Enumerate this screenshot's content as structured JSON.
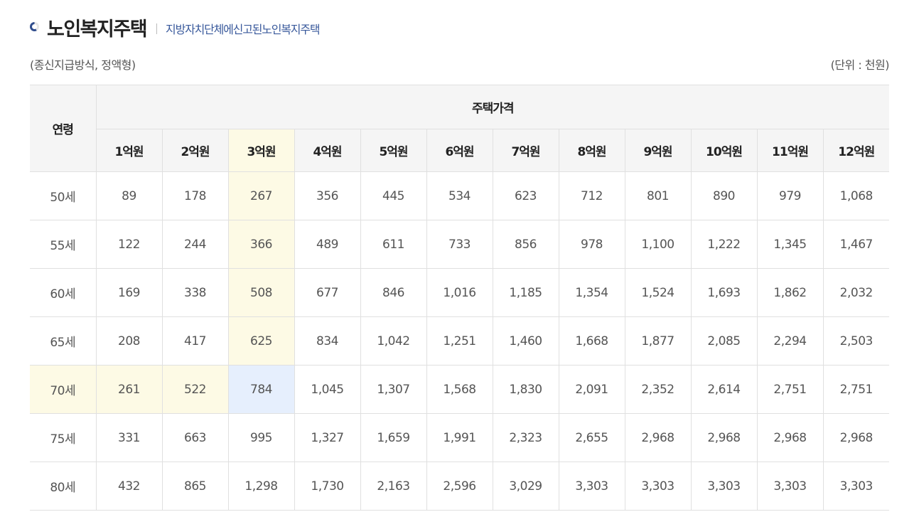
{
  "page": {
    "title": "노인복지주택",
    "subtitle": "지방자치단체에신고된노인복지주택",
    "note_left": "(종신지급방식, 정액형)",
    "note_right": "(단위 : 천원)"
  },
  "table": {
    "age_header": "연령",
    "group_header": "주택가격",
    "columns": [
      "1억원",
      "2억원",
      "3억원",
      "4억원",
      "5억원",
      "6억원",
      "7억원",
      "8억원",
      "9억원",
      "10억원",
      "11억원",
      "12억원"
    ],
    "highlight": {
      "column": "3억원",
      "row": "70세"
    },
    "rows": [
      {
        "age": "50세",
        "values": [
          "89",
          "178",
          "267",
          "356",
          "445",
          "534",
          "623",
          "712",
          "801",
          "890",
          "979",
          "1,068"
        ]
      },
      {
        "age": "55세",
        "values": [
          "122",
          "244",
          "366",
          "489",
          "611",
          "733",
          "856",
          "978",
          "1,100",
          "1,222",
          "1,345",
          "1,467"
        ]
      },
      {
        "age": "60세",
        "values": [
          "169",
          "338",
          "508",
          "677",
          "846",
          "1,016",
          "1,185",
          "1,354",
          "1,524",
          "1,693",
          "1,862",
          "2,032"
        ]
      },
      {
        "age": "65세",
        "values": [
          "208",
          "417",
          "625",
          "834",
          "1,042",
          "1,251",
          "1,460",
          "1,668",
          "1,877",
          "2,085",
          "2,294",
          "2,503"
        ]
      },
      {
        "age": "70세",
        "values": [
          "261",
          "522",
          "784",
          "1,045",
          "1,307",
          "1,568",
          "1,830",
          "2,091",
          "2,352",
          "2,614",
          "2,751",
          "2,751"
        ]
      },
      {
        "age": "75세",
        "values": [
          "331",
          "663",
          "995",
          "1,327",
          "1,659",
          "1,991",
          "2,323",
          "2,655",
          "2,968",
          "2,968",
          "2,968",
          "2,968"
        ]
      },
      {
        "age": "80세",
        "values": [
          "432",
          "865",
          "1,298",
          "1,730",
          "2,163",
          "2,596",
          "3,029",
          "3,303",
          "3,303",
          "3,303",
          "3,303",
          "3,303"
        ]
      }
    ]
  },
  "colors": {
    "highlight_bg": "#fdfae5",
    "intersection_bg": "#e6effd",
    "header_bg": "#f5f5f5",
    "subtitle": "#3a5a9c"
  }
}
